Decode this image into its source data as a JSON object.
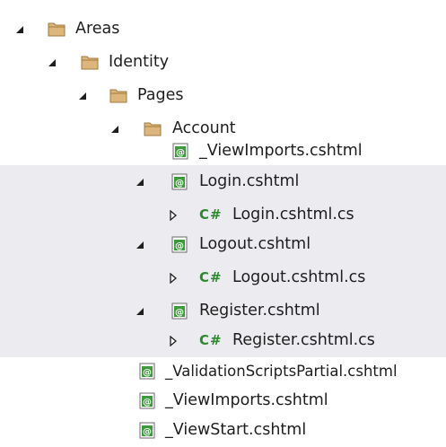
{
  "tree": {
    "areas": "Areas",
    "identity": "Identity",
    "pages": "Pages",
    "account": "Account",
    "viewimports_account": "_ViewImports.cshtml",
    "login": "Login.cshtml",
    "login_cs": "Login.cshtml.cs",
    "logout": "Logout.cshtml",
    "logout_cs": "Logout.cshtml.cs",
    "register": "Register.cshtml",
    "register_cs": "Register.cshtml.cs",
    "validation_partial": "_ValidationScriptsPartial.cshtml",
    "viewimports_pages": "_ViewImports.cshtml",
    "viewstart": "_ViewStart.cshtml"
  },
  "icons": {
    "folder": "folder-icon",
    "razor": "razor-file-icon",
    "csharp": "csharp-file-icon",
    "expanded": "expanded-triangle-icon",
    "collapsed": "collapsed-triangle-icon"
  },
  "colors": {
    "highlight_row": "#ebebf0",
    "folder_fill": "#dcb67a",
    "razor_green": "#3c9a3c",
    "csharp_green": "#2b8a2b"
  },
  "csharp_glyph": "C#"
}
